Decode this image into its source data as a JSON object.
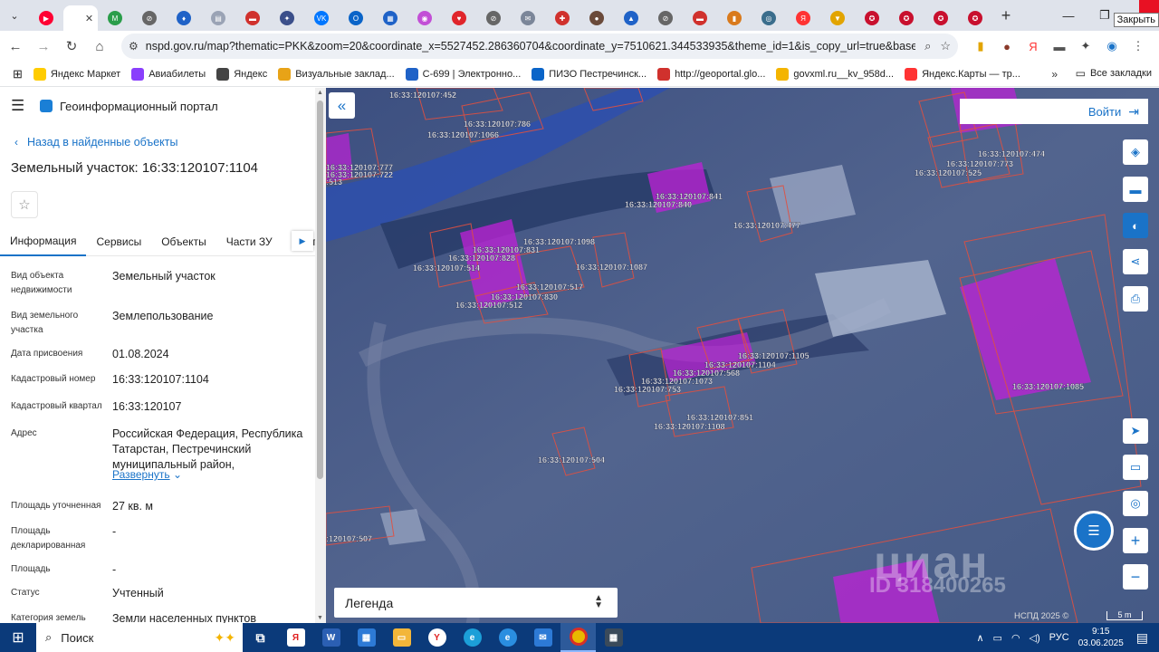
{
  "browser": {
    "tabs": [
      {
        "color": "#ff0033",
        "glyph": "▶"
      },
      {
        "color": "#ffffff",
        "glyph": "",
        "active": true
      },
      {
        "color": "#2a9d4a",
        "glyph": "M"
      },
      {
        "color": "#666666",
        "glyph": "⊘"
      },
      {
        "color": "#1f62c7",
        "glyph": "♦"
      },
      {
        "color": "#9aa3b5",
        "glyph": "▤"
      },
      {
        "color": "#d0312d",
        "glyph": "▬"
      },
      {
        "color": "#3b4f8a",
        "glyph": "✦"
      },
      {
        "color": "#0077ff",
        "glyph": "VK"
      },
      {
        "color": "#0a64c8",
        "glyph": "O"
      },
      {
        "color": "#1f62c7",
        "glyph": "▦"
      },
      {
        "color": "#c24fd6",
        "glyph": "◉"
      },
      {
        "color": "#e0252b",
        "glyph": "♥"
      },
      {
        "color": "#666666",
        "glyph": "⊘"
      },
      {
        "color": "#7b8699",
        "glyph": "✉"
      },
      {
        "color": "#d0312d",
        "glyph": "✚"
      },
      {
        "color": "#6a4a3a",
        "glyph": "●"
      },
      {
        "color": "#1f62c7",
        "glyph": "▲"
      },
      {
        "color": "#666666",
        "glyph": "⊘"
      },
      {
        "color": "#d0312d",
        "glyph": "▬"
      },
      {
        "color": "#d97a1c",
        "glyph": "▮"
      },
      {
        "color": "#3a6d8c",
        "glyph": "◎"
      },
      {
        "color": "#ff3333",
        "glyph": "Я"
      },
      {
        "color": "#e2a400",
        "glyph": "▼"
      },
      {
        "color": "#c8102e",
        "glyph": "✪"
      },
      {
        "color": "#c8102e",
        "glyph": "✪"
      },
      {
        "color": "#c8102e",
        "glyph": "✪"
      },
      {
        "color": "#c8102e",
        "glyph": "✪"
      }
    ],
    "close_tooltip": "Закрыть",
    "url": "nspd.gov.ru/map?thematic=PKK&zoom=20&coordinate_x=5527452.286360704&coordinate_y=7510621.344533935&theme_id=1&is_copy_url=true&baseLayerId=363...",
    "bookmarks": [
      {
        "label": "Яндекс Маркет",
        "color": "#ffcc00"
      },
      {
        "label": "Авиабилеты",
        "color": "#8a3ffc"
      },
      {
        "label": "Яндекс",
        "color": "#444444"
      },
      {
        "label": "Визуальные заклад...",
        "color": "#e8a317"
      },
      {
        "label": "С-699 | Электронно...",
        "color": "#1f62c7"
      },
      {
        "label": "ПИЗО Пестречинск...",
        "color": "#0a64c8"
      },
      {
        "label": "http://geoportal.glo...",
        "color": "#d0312d"
      },
      {
        "label": "govxml.ru__kv_958d...",
        "color": "#f4b400"
      },
      {
        "label": "Яндекс.Карты — тр...",
        "color": "#ff3333"
      }
    ],
    "all_bookmarks": "Все закладки"
  },
  "panel": {
    "portal_title": "Геоинформационный портал",
    "back_label": "Назад в найденные объекты",
    "object_title": "Земельный участок: 16:33:120107:1104",
    "tabs": [
      "Информация",
      "Сервисы",
      "Объекты",
      "Части ЗУ",
      "Соста"
    ],
    "props": [
      {
        "label": "Вид объекта недвижимости",
        "value": "Земельный участок"
      },
      {
        "label": "Вид земельного участка",
        "value": "Землепользование"
      },
      {
        "label": "Дата присвоения",
        "value": "01.08.2024"
      },
      {
        "label": "Кадастровый номер",
        "value": "16:33:120107:1104"
      },
      {
        "label": "Кадастровый квартал",
        "value": "16:33:120107"
      },
      {
        "label": "Адрес",
        "value": "Российская Федерация, Республика Татарстан, Пестречинский муниципальный район,"
      },
      {
        "label": "Площадь уточненная",
        "value": "27 кв. м"
      },
      {
        "label": "Площадь декларированная",
        "value": "-"
      },
      {
        "label": "Площадь",
        "value": "-"
      },
      {
        "label": "Статус",
        "value": "Учтенный"
      },
      {
        "label": "Категория земель",
        "value": "Земли населенных пунктов"
      }
    ],
    "expand_label": "Развернуть"
  },
  "map": {
    "login_label": "Войти",
    "legend_label": "Легенда",
    "attribution": "НСПД 2025 ©",
    "scale_label": "5 m",
    "watermark_name": "циан",
    "watermark_id": "ID 318400265",
    "parcel_labels": [
      "16:33:120107:452",
      "16:33:120107:786",
      "16:33:120107:1066",
      "16:33:120107:777",
      "16:33:120107:722",
      ":513",
      "16:33:120107:841",
      "16:33:120107:840",
      "16:33:120107:477",
      "16:33:120107:474",
      "16:33:120107:773",
      "16:33:120107:525",
      "16:33:120107:1098",
      "16:33:120107:831",
      "16:33:120107:828",
      "16:33:120107:514",
      "16:33:120107:1087",
      "16:33:120107:517",
      "16:33:120107:830",
      "16:33:120107:512",
      "16:33:120107:1105",
      "16:33:120107:1104",
      "16:33:120107:568",
      "16:33:120107:1073",
      "16:33:120107:753",
      "16:33:120107:851",
      "16:33:120107:1108",
      "16:33:120107:504",
      "16:33:120107:1085",
      ":120107:507"
    ]
  },
  "taskbar": {
    "search_label": "Поиск",
    "lang": "РУС",
    "time": "9:15",
    "date": "03.06.2025"
  },
  "colors": {
    "accent": "#1a73c8",
    "parcel_fill": "#c020d8",
    "parcel_border": "#e05040",
    "taskbar": "#0b3a7a"
  }
}
